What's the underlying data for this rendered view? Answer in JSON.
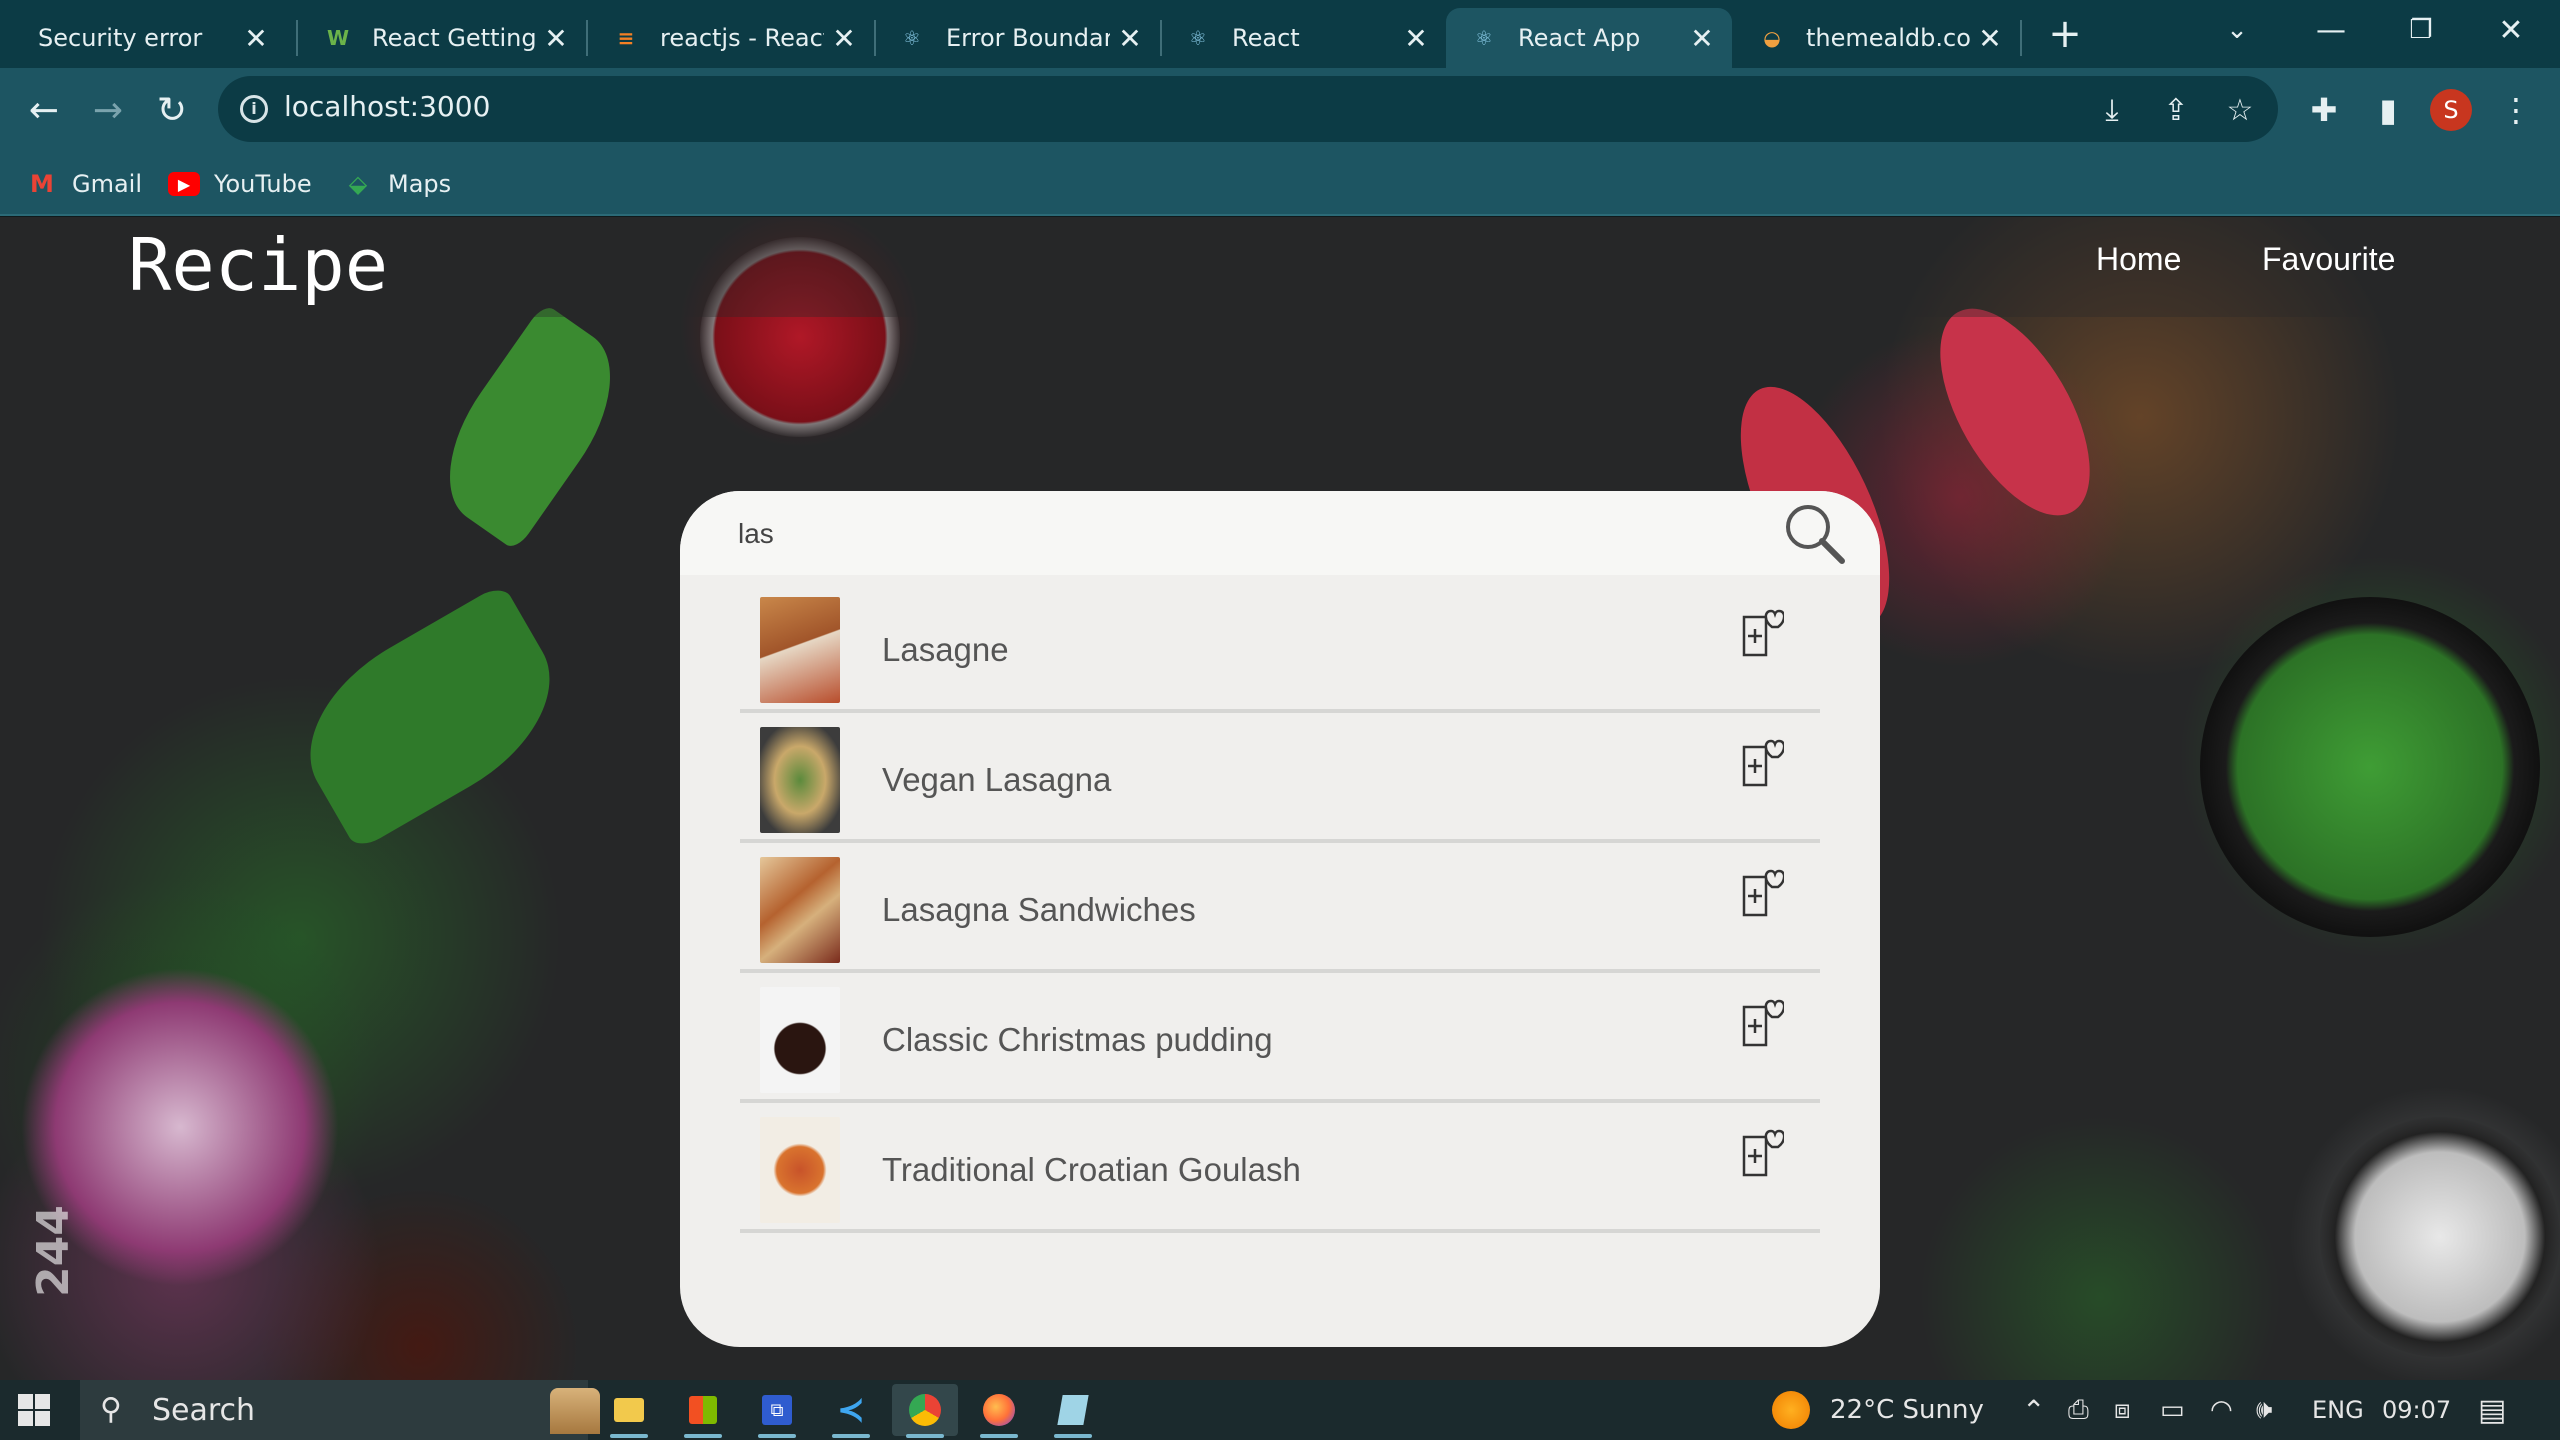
{
  "browser": {
    "tabs": [
      {
        "title": "Security error",
        "icon": "warning-icon"
      },
      {
        "title": "React Getting",
        "icon": "w3schools-icon"
      },
      {
        "title": "reactjs - React",
        "icon": "stackoverflow-icon"
      },
      {
        "title": "Error Boundar",
        "icon": "react-icon"
      },
      {
        "title": "React",
        "icon": "react-icon"
      },
      {
        "title": "React App",
        "icon": "react-icon",
        "active": true
      },
      {
        "title": "themealdb.co",
        "icon": "mealdb-icon"
      }
    ],
    "url": "localhost:3000",
    "profile_initial": "S",
    "bookmarks": [
      {
        "label": "Gmail",
        "icon": "gmail-icon"
      },
      {
        "label": "YouTube",
        "icon": "youtube-icon"
      },
      {
        "label": "Maps",
        "icon": "maps-icon"
      }
    ]
  },
  "app": {
    "brand": "Recipe",
    "nav": {
      "home": "Home",
      "favourite": "Favourite"
    },
    "search": {
      "value": "las"
    },
    "results": [
      {
        "name": "Lasagne"
      },
      {
        "name": "Vegan Lasagna"
      },
      {
        "name": "Lasagna Sandwiches"
      },
      {
        "name": "Classic Christmas pudding"
      },
      {
        "name": "Traditional Croatian Goulash"
      }
    ]
  },
  "background": {
    "watermark_text": "244"
  },
  "taskbar": {
    "search_label": "Search",
    "weather": "22°C  Sunny",
    "language": "ENG",
    "time": "09:07"
  }
}
